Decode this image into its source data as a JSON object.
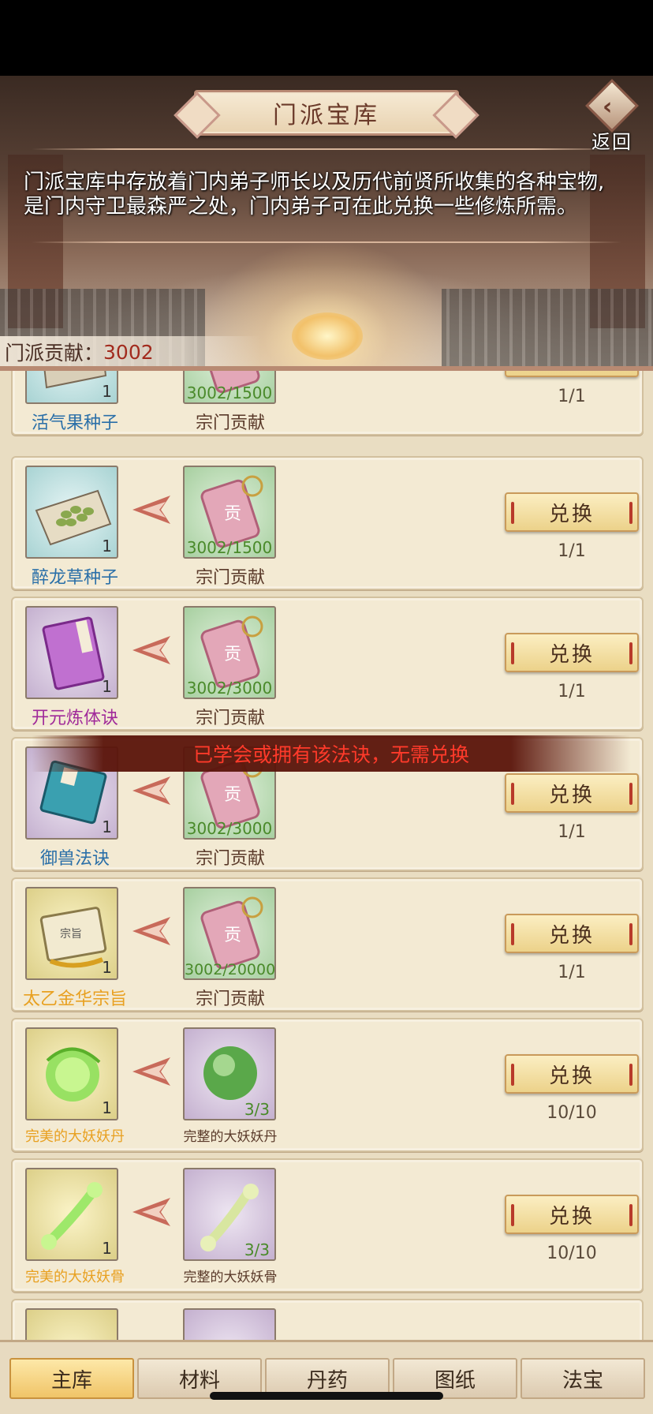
{
  "header": {
    "title": "门派宝库",
    "back_label": "返回",
    "description_line1": "门派宝库中存放着门内弟子师长以及历代前贤所收集的各种宝物,",
    "description_line2": "是门内守卫最森严之处，门内弟子可在此兑换一些修炼所需。",
    "contribution_label": "门派贡献：",
    "contribution_value": "3002"
  },
  "exchange_button_label": "兑换",
  "warning_text": "已学会或拥有该法诀，无需兑换",
  "items": [
    {
      "name": "活气果种子",
      "count": "1",
      "cost": "3002/1500",
      "cost_name": "宗门贡献",
      "limit": "1/1"
    },
    {
      "name": "醉龙草种子",
      "count": "1",
      "cost": "3002/1500",
      "cost_name": "宗门贡献",
      "limit": "1/1"
    },
    {
      "name": "开元炼体诀",
      "count": "1",
      "cost": "3002/3000",
      "cost_name": "宗门贡献",
      "limit": "1/1"
    },
    {
      "name": "御兽法诀",
      "count": "1",
      "cost": "3002/3000",
      "cost_name": "宗门贡献",
      "limit": "1/1"
    },
    {
      "name": "太乙金华宗旨",
      "count": "1",
      "cost": "3002/20000",
      "cost_name": "宗门贡献",
      "limit": "1/1"
    },
    {
      "name": "完美的大妖妖丹",
      "count": "1",
      "cost": "3/3",
      "cost_name": "完整的大妖妖丹",
      "limit": "10/10"
    },
    {
      "name": "完美的大妖妖骨",
      "count": "1",
      "cost": "3/3",
      "cost_name": "完整的大妖妖骨",
      "limit": "10/10"
    }
  ],
  "tabs": [
    {
      "label": "主库",
      "active": true
    },
    {
      "label": "材料",
      "active": false
    },
    {
      "label": "丹药",
      "active": false
    },
    {
      "label": "图纸",
      "active": false
    },
    {
      "label": "法宝",
      "active": false
    }
  ],
  "colors": {
    "contribution_value": "#a22b1e",
    "warning": "#ff3a2a",
    "cost_green": "#4a8a2a"
  }
}
